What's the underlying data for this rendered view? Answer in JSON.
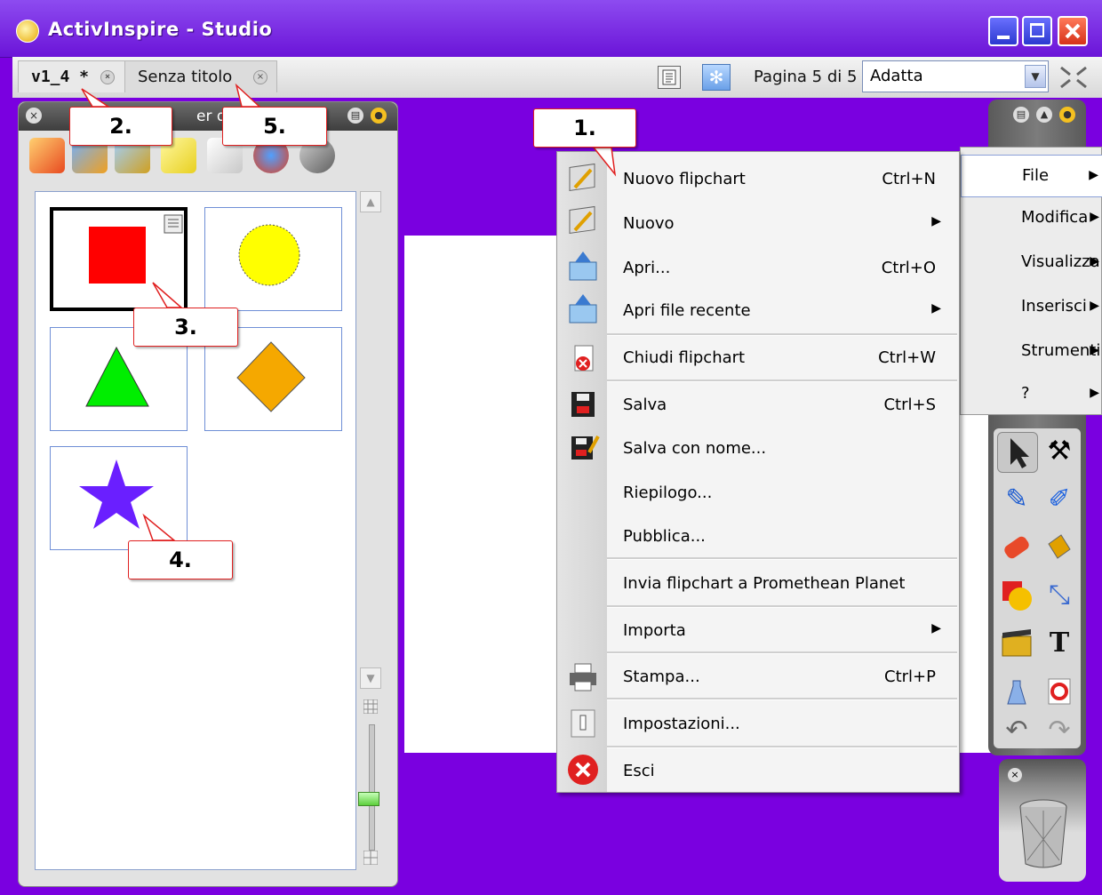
{
  "window": {
    "title": "ActivInspire - Studio",
    "accent": "#7a00e0"
  },
  "tabs": [
    {
      "label": "v1_4 *"
    },
    {
      "label": "Senza titolo"
    }
  ],
  "toolbar": {
    "page_label": "Pagina 5 di 5",
    "zoom_value": "Adatta"
  },
  "browser": {
    "title": "er dell"
  },
  "file_menu": {
    "items": [
      {
        "label": "Nuovo flipchart",
        "shortcut": "Ctrl+N",
        "icon": "new-flipchart-icon"
      },
      {
        "label": "Nuovo",
        "shortcut": "",
        "icon": "new-icon"
      },
      {
        "label": "Apri...",
        "shortcut": "Ctrl+O",
        "icon": "open-icon"
      },
      {
        "label": "Apri file recente",
        "shortcut": "",
        "icon": "open-recent-icon"
      },
      {
        "label": "Chiudi flipchart",
        "shortcut": "Ctrl+W",
        "icon": "close-doc-icon"
      },
      {
        "label": "Salva",
        "shortcut": "Ctrl+S",
        "icon": "save-icon"
      },
      {
        "label": "Salva con nome...",
        "shortcut": "",
        "icon": "save-as-icon"
      },
      {
        "label": "Riepilogo...",
        "shortcut": ""
      },
      {
        "label": "Pubblica...",
        "shortcut": ""
      },
      {
        "label": "Invia flipchart a Promethean Planet",
        "shortcut": ""
      },
      {
        "label": "Importa",
        "shortcut": ""
      },
      {
        "label": "Stampa...",
        "shortcut": "Ctrl+P",
        "icon": "print-icon"
      },
      {
        "label": "Impostazioni...",
        "shortcut": "",
        "icon": "settings-icon"
      },
      {
        "label": "Esci",
        "shortcut": "",
        "icon": "exit-icon"
      }
    ]
  },
  "menubar": {
    "items": [
      {
        "label": "File"
      },
      {
        "label": "Modifica"
      },
      {
        "label": "Visualizza"
      },
      {
        "label": "Inserisci"
      },
      {
        "label": "Strumenti"
      },
      {
        "label": "?"
      }
    ]
  },
  "callouts": [
    "1.",
    "2.",
    "3.",
    "4.",
    "5."
  ],
  "pages": [
    {
      "shape": "red-square",
      "color": "#ff0000"
    },
    {
      "shape": "yellow-circle",
      "color": "#ffff00"
    },
    {
      "shape": "green-triangle",
      "color": "#00ee00"
    },
    {
      "shape": "orange-diamond",
      "color": "#f5a800"
    },
    {
      "shape": "purple-star",
      "color": "#6a1fff"
    }
  ]
}
